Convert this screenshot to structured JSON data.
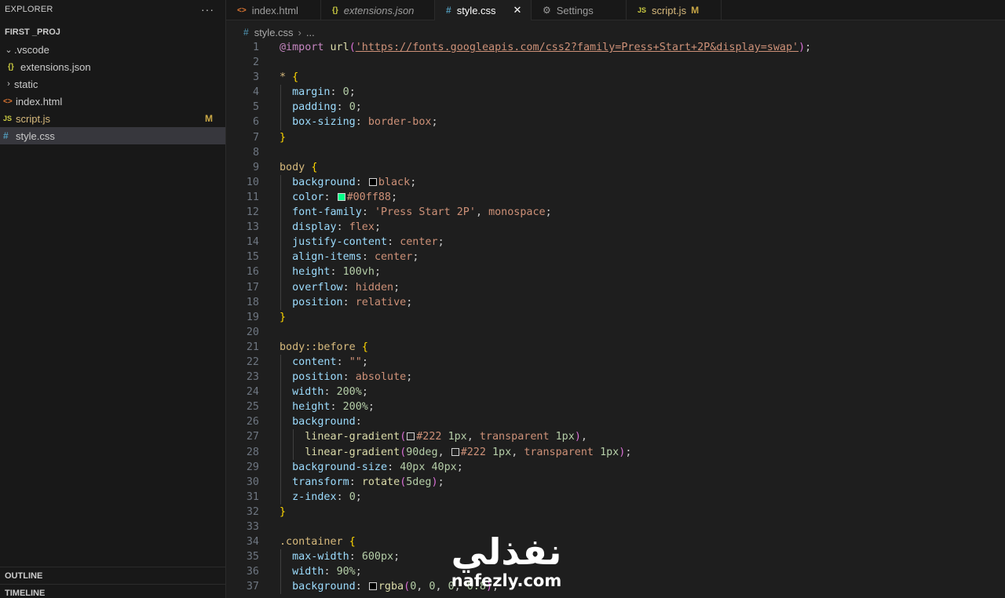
{
  "sidebar": {
    "title": "EXPLORER",
    "more": "···",
    "project": "FIRST _PROJ",
    "items": [
      {
        "label": ".vscode",
        "chevron": "⌄"
      },
      {
        "label": "extensions.json",
        "icon": "{}"
      },
      {
        "label": "static",
        "chevron": "›"
      },
      {
        "label": "index.html",
        "icon": "<>"
      },
      {
        "label": "script.js",
        "icon": "JS",
        "badge": "M"
      },
      {
        "label": "style.css",
        "icon": "#"
      }
    ],
    "outline": "OUTLINE",
    "timeline": "TIMELINE"
  },
  "tabs": [
    {
      "label": "index.html",
      "icon": "<>"
    },
    {
      "label": "extensions.json",
      "icon": "{}"
    },
    {
      "label": "style.css",
      "icon": "#",
      "close": "✕"
    },
    {
      "label": "Settings",
      "icon": "⚙"
    },
    {
      "label": "script.js",
      "icon": "JS",
      "badge": "M"
    }
  ],
  "breadcrumb": {
    "icon": "#",
    "file": "style.css",
    "sep": "›",
    "more": "..."
  },
  "colors": {
    "background": "#1e1e1e",
    "sidebar": "#181818",
    "keyword": "#c586c0",
    "property": "#9cdcfe",
    "string": "#ce9178",
    "number": "#b5cea8",
    "brace": "#ffd700",
    "function": "#dcdcaa",
    "swatch_black": "#000000",
    "swatch_green": "#00ff88",
    "swatch_222": "#222222"
  },
  "lines": [
    [
      [
        "t-at",
        "@import"
      ],
      [
        "t-punc",
        " "
      ],
      [
        "t-fn",
        "url"
      ],
      [
        "t-paren",
        "("
      ],
      [
        "t-url",
        "'https://fonts.googleapis.com/css2?family=Press+Start+2P&display=swap'"
      ],
      [
        "t-paren",
        ")"
      ],
      [
        "t-punc",
        ";"
      ]
    ],
    [],
    [
      [
        "t-sel",
        "*"
      ],
      [
        "t-punc",
        " "
      ],
      [
        "t-brace",
        "{"
      ]
    ],
    [
      [
        "t-punc",
        "  "
      ],
      [
        "t-prop",
        "margin"
      ],
      [
        "t-punc",
        ": "
      ],
      [
        "t-num",
        "0"
      ],
      [
        "t-punc",
        ";"
      ]
    ],
    [
      [
        "t-punc",
        "  "
      ],
      [
        "t-prop",
        "padding"
      ],
      [
        "t-punc",
        ": "
      ],
      [
        "t-num",
        "0"
      ],
      [
        "t-punc",
        ";"
      ]
    ],
    [
      [
        "t-punc",
        "  "
      ],
      [
        "t-prop",
        "box-sizing"
      ],
      [
        "t-punc",
        ": "
      ],
      [
        "t-val",
        "border-box"
      ],
      [
        "t-punc",
        ";"
      ]
    ],
    [
      [
        "t-brace",
        "}"
      ]
    ],
    [],
    [
      [
        "t-sel",
        "body"
      ],
      [
        "t-punc",
        " "
      ],
      [
        "t-brace",
        "{"
      ]
    ],
    [
      [
        "t-punc",
        "  "
      ],
      [
        "t-prop",
        "background"
      ],
      [
        "t-punc",
        ": "
      ],
      [
        "swatch",
        "#000000"
      ],
      [
        "t-val",
        "black"
      ],
      [
        "t-punc",
        ";"
      ]
    ],
    [
      [
        "t-punc",
        "  "
      ],
      [
        "t-prop",
        "color"
      ],
      [
        "t-punc",
        ": "
      ],
      [
        "swatch",
        "#00ff88"
      ],
      [
        "t-val",
        "#00ff88"
      ],
      [
        "t-punc",
        ";"
      ]
    ],
    [
      [
        "t-punc",
        "  "
      ],
      [
        "t-prop",
        "font-family"
      ],
      [
        "t-punc",
        ": "
      ],
      [
        "t-str",
        "'Press Start 2P'"
      ],
      [
        "t-punc",
        ", "
      ],
      [
        "t-val",
        "monospace"
      ],
      [
        "t-punc",
        ";"
      ]
    ],
    [
      [
        "t-punc",
        "  "
      ],
      [
        "t-prop",
        "display"
      ],
      [
        "t-punc",
        ": "
      ],
      [
        "t-val",
        "flex"
      ],
      [
        "t-punc",
        ";"
      ]
    ],
    [
      [
        "t-punc",
        "  "
      ],
      [
        "t-prop",
        "justify-content"
      ],
      [
        "t-punc",
        ": "
      ],
      [
        "t-val",
        "center"
      ],
      [
        "t-punc",
        ";"
      ]
    ],
    [
      [
        "t-punc",
        "  "
      ],
      [
        "t-prop",
        "align-items"
      ],
      [
        "t-punc",
        ": "
      ],
      [
        "t-val",
        "center"
      ],
      [
        "t-punc",
        ";"
      ]
    ],
    [
      [
        "t-punc",
        "  "
      ],
      [
        "t-prop",
        "height"
      ],
      [
        "t-punc",
        ": "
      ],
      [
        "t-num",
        "100vh"
      ],
      [
        "t-punc",
        ";"
      ]
    ],
    [
      [
        "t-punc",
        "  "
      ],
      [
        "t-prop",
        "overflow"
      ],
      [
        "t-punc",
        ": "
      ],
      [
        "t-val",
        "hidden"
      ],
      [
        "t-punc",
        ";"
      ]
    ],
    [
      [
        "t-punc",
        "  "
      ],
      [
        "t-prop",
        "position"
      ],
      [
        "t-punc",
        ": "
      ],
      [
        "t-val",
        "relative"
      ],
      [
        "t-punc",
        ";"
      ]
    ],
    [
      [
        "t-brace",
        "}"
      ]
    ],
    [],
    [
      [
        "t-sel",
        "body::before"
      ],
      [
        "t-punc",
        " "
      ],
      [
        "t-brace",
        "{"
      ]
    ],
    [
      [
        "t-punc",
        "  "
      ],
      [
        "t-prop",
        "content"
      ],
      [
        "t-punc",
        ": "
      ],
      [
        "t-str",
        "\"\""
      ],
      [
        "t-punc",
        ";"
      ]
    ],
    [
      [
        "t-punc",
        "  "
      ],
      [
        "t-prop",
        "position"
      ],
      [
        "t-punc",
        ": "
      ],
      [
        "t-val",
        "absolute"
      ],
      [
        "t-punc",
        ";"
      ]
    ],
    [
      [
        "t-punc",
        "  "
      ],
      [
        "t-prop",
        "width"
      ],
      [
        "t-punc",
        ": "
      ],
      [
        "t-num",
        "200%"
      ],
      [
        "t-punc",
        ";"
      ]
    ],
    [
      [
        "t-punc",
        "  "
      ],
      [
        "t-prop",
        "height"
      ],
      [
        "t-punc",
        ": "
      ],
      [
        "t-num",
        "200%"
      ],
      [
        "t-punc",
        ";"
      ]
    ],
    [
      [
        "t-punc",
        "  "
      ],
      [
        "t-prop",
        "background"
      ],
      [
        "t-punc",
        ":"
      ]
    ],
    [
      [
        "t-punc",
        "    "
      ],
      [
        "t-fn",
        "linear-gradient"
      ],
      [
        "t-paren",
        "("
      ],
      [
        "swatch",
        "#222222"
      ],
      [
        "t-val",
        "#222"
      ],
      [
        "t-punc",
        " "
      ],
      [
        "t-num",
        "1px"
      ],
      [
        "t-punc",
        ", "
      ],
      [
        "t-val",
        "transparent"
      ],
      [
        "t-punc",
        " "
      ],
      [
        "t-num",
        "1px"
      ],
      [
        "t-paren",
        ")"
      ],
      [
        "t-punc",
        ","
      ]
    ],
    [
      [
        "t-punc",
        "    "
      ],
      [
        "t-fn",
        "linear-gradient"
      ],
      [
        "t-paren",
        "("
      ],
      [
        "t-num",
        "90deg"
      ],
      [
        "t-punc",
        ", "
      ],
      [
        "swatch",
        "#222222"
      ],
      [
        "t-val",
        "#222"
      ],
      [
        "t-punc",
        " "
      ],
      [
        "t-num",
        "1px"
      ],
      [
        "t-punc",
        ", "
      ],
      [
        "t-val",
        "transparent"
      ],
      [
        "t-punc",
        " "
      ],
      [
        "t-num",
        "1px"
      ],
      [
        "t-paren",
        ")"
      ],
      [
        "t-punc",
        ";"
      ]
    ],
    [
      [
        "t-punc",
        "  "
      ],
      [
        "t-prop",
        "background-size"
      ],
      [
        "t-punc",
        ": "
      ],
      [
        "t-num",
        "40px"
      ],
      [
        "t-punc",
        " "
      ],
      [
        "t-num",
        "40px"
      ],
      [
        "t-punc",
        ";"
      ]
    ],
    [
      [
        "t-punc",
        "  "
      ],
      [
        "t-prop",
        "transform"
      ],
      [
        "t-punc",
        ": "
      ],
      [
        "t-fn",
        "rotate"
      ],
      [
        "t-paren",
        "("
      ],
      [
        "t-num",
        "5deg"
      ],
      [
        "t-paren",
        ")"
      ],
      [
        "t-punc",
        ";"
      ]
    ],
    [
      [
        "t-punc",
        "  "
      ],
      [
        "t-prop",
        "z-index"
      ],
      [
        "t-punc",
        ": "
      ],
      [
        "t-num",
        "0"
      ],
      [
        "t-punc",
        ";"
      ]
    ],
    [
      [
        "t-brace",
        "}"
      ]
    ],
    [],
    [
      [
        "t-sel",
        ".container"
      ],
      [
        "t-punc",
        " "
      ],
      [
        "t-brace",
        "{"
      ]
    ],
    [
      [
        "t-punc",
        "  "
      ],
      [
        "t-prop",
        "max-width"
      ],
      [
        "t-punc",
        ": "
      ],
      [
        "t-num",
        "600px"
      ],
      [
        "t-punc",
        ";"
      ]
    ],
    [
      [
        "t-punc",
        "  "
      ],
      [
        "t-prop",
        "width"
      ],
      [
        "t-punc",
        ": "
      ],
      [
        "t-num",
        "90%"
      ],
      [
        "t-punc",
        ";"
      ]
    ],
    [
      [
        "t-punc",
        "  "
      ],
      [
        "t-prop",
        "background"
      ],
      [
        "t-punc",
        ": "
      ],
      [
        "swatch",
        "#000000"
      ],
      [
        "t-fn",
        "rgba"
      ],
      [
        "t-paren",
        "("
      ],
      [
        "t-num",
        "0"
      ],
      [
        "t-punc",
        ", "
      ],
      [
        "t-num",
        "0"
      ],
      [
        "t-punc",
        ", "
      ],
      [
        "t-num",
        "0"
      ],
      [
        "t-punc",
        ", "
      ],
      [
        "t-num",
        "0.8"
      ],
      [
        "t-paren",
        ")"
      ],
      [
        "t-punc",
        ";"
      ]
    ]
  ],
  "watermark": {
    "logo": "نفذلي",
    "url": "nafezly.com"
  }
}
